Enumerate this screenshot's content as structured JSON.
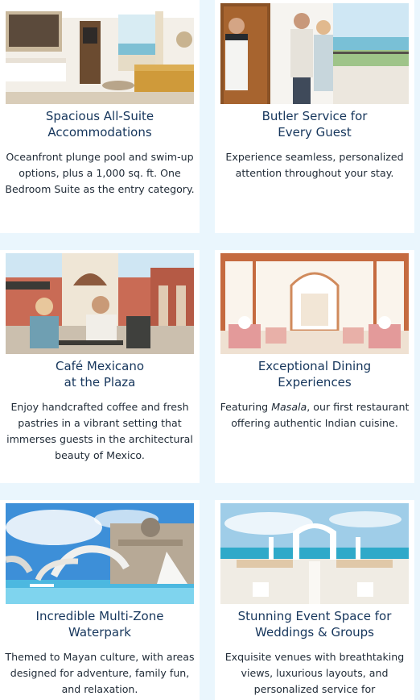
{
  "cards": [
    {
      "image_alt": "Suite interior with bed, sofa and ocean view",
      "title_line1": "Spacious All-Suite",
      "title_line2": "Accommodations",
      "description": "Oceanfront plunge pool and swim-up options, plus a 1,000 sq. ft. One Bedroom Suite as the entry category."
    },
    {
      "image_alt": "Butler greeting a couple at the suite door",
      "title_line1": "Butler Service for",
      "title_line2": "Every Guest",
      "description": "Experience seamless, personalized attention throughout your stay."
    },
    {
      "image_alt": "Couple sharing coffee at an outdoor plaza café",
      "title_line1": "Café Mexicano",
      "title_line2": "at the Plaza",
      "description": "Enjoy handcrafted coffee and fresh pastries in a vibrant setting that immerses guests in the architectural beauty of Mexico."
    },
    {
      "image_alt": "Elegant restaurant dining room with arched windows",
      "title_line1": "Exceptional Dining",
      "title_line2": "Experiences",
      "description_before": "Featuring ",
      "description_emphasis": "Masala",
      "description_after": ", our first restaurant offering authentic Indian cuisine."
    },
    {
      "image_alt": "Waterpark with slides and Mayan-themed structures",
      "title_line1": "Incredible Multi-Zone",
      "title_line2": "Waterpark",
      "description": "Themed to Mayan culture, with areas designed for adventure, family fun, and relaxation."
    },
    {
      "image_alt": "Oceanfront wedding ceremony setup with white arch",
      "title_line1": "Stunning Event Space for",
      "title_line2": "Weddings & Groups",
      "description": "Exquisite venues with breathtaking views, luxurious layouts, and personalized service for"
    }
  ]
}
